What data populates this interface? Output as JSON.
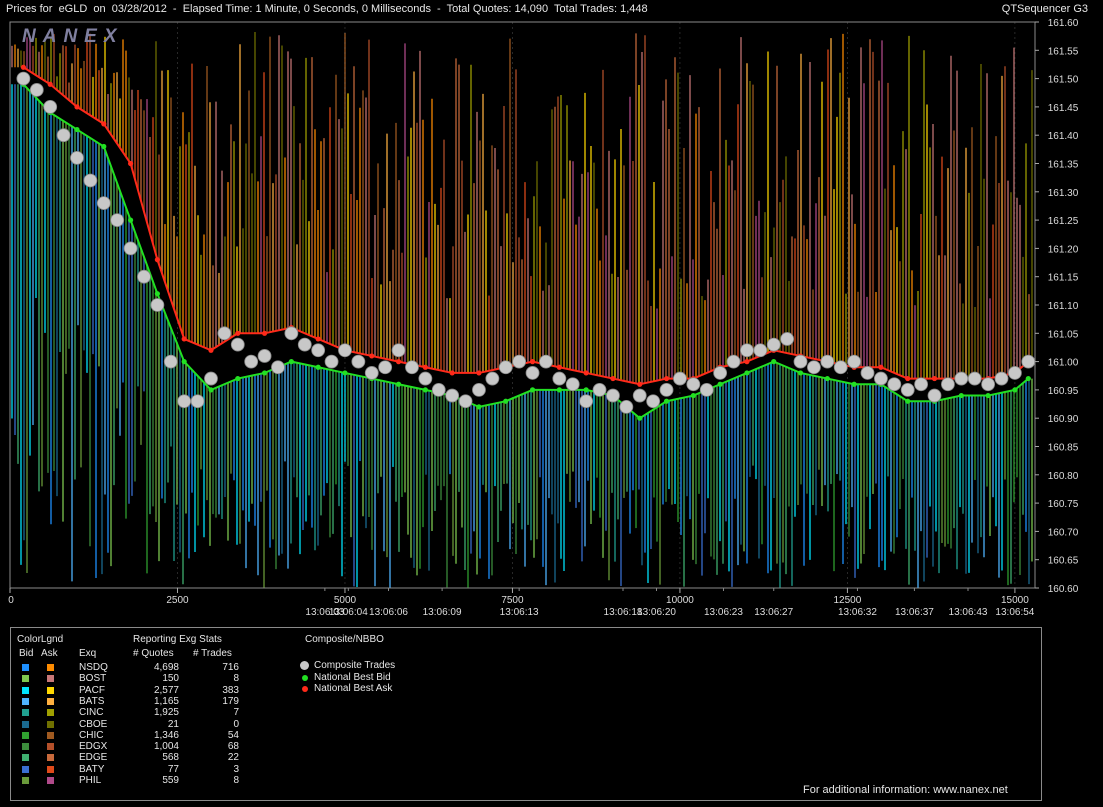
{
  "window": {
    "title": "Prices for  eGLD  on  03/28/2012  -  Elapsed Time: 1 Minute, 0 Seconds, 0 Milliseconds  -  Total Quotes: 14,090  Total Trades: 1,448",
    "app_name": "QTSequencer G3"
  },
  "watermark": "NANEX",
  "chart_data": {
    "type": "line",
    "title": "",
    "xlabel": "",
    "ylabel": "",
    "ylim": [
      160.6,
      161.6
    ],
    "xlim": [
      0,
      15300
    ],
    "y_ticks": [
      "161.60",
      "161.55",
      "161.50",
      "161.45",
      "161.40",
      "161.35",
      "161.30",
      "161.25",
      "161.20",
      "161.15",
      "161.10",
      "161.05",
      "161.00",
      "160.95",
      "160.90",
      "160.85",
      "160.80",
      "160.75",
      "160.70",
      "160.65",
      "160.60"
    ],
    "x_ticks": [
      {
        "x": 0,
        "label": "0"
      },
      {
        "x": 2500,
        "label": "2500"
      },
      {
        "x": 5000,
        "label": "5000"
      },
      {
        "x": 7500,
        "label": "7500"
      },
      {
        "x": 10000,
        "label": "10000"
      },
      {
        "x": 12500,
        "label": "12500"
      },
      {
        "x": 15000,
        "label": "15000"
      }
    ],
    "time_ticks": [
      {
        "x": 4700,
        "label": "13:06:03"
      },
      {
        "x": 5050,
        "label": "13:06:04"
      },
      {
        "x": 5650,
        "label": "13:06:06"
      },
      {
        "x": 6450,
        "label": "13:06:09"
      },
      {
        "x": 7600,
        "label": "13:06:13"
      },
      {
        "x": 9150,
        "label": "13:06:18"
      },
      {
        "x": 9650,
        "label": "13:06:20"
      },
      {
        "x": 10650,
        "label": "13:06:23"
      },
      {
        "x": 11400,
        "label": "13:06:27"
      },
      {
        "x": 12650,
        "label": "13:06:32"
      },
      {
        "x": 13500,
        "label": "13:06:37"
      },
      {
        "x": 14300,
        "label": "13:06:43"
      },
      {
        "x": 15000,
        "label": "13:06:54"
      }
    ],
    "series": [
      {
        "name": "Composite Trades",
        "color": "#c8c8c8",
        "x": [
          200,
          400,
          600,
          800,
          1000,
          1200,
          1400,
          1600,
          1800,
          2000,
          2200,
          2400,
          2600,
          2800,
          3000,
          3200,
          3400,
          3600,
          3800,
          4000,
          4200,
          4400,
          4600,
          4800,
          5000,
          5200,
          5400,
          5600,
          5800,
          6000,
          6200,
          6400,
          6600,
          6800,
          7000,
          7200,
          7400,
          7600,
          7800,
          8000,
          8200,
          8400,
          8600,
          8800,
          9000,
          9200,
          9400,
          9600,
          9800,
          10000,
          10200,
          10400,
          10600,
          10800,
          11000,
          11200,
          11400,
          11600,
          11800,
          12000,
          12200,
          12400,
          12600,
          12800,
          13000,
          13200,
          13400,
          13600,
          13800,
          14000,
          14200,
          14400,
          14600,
          14800,
          15000,
          15200
        ],
        "y": [
          161.5,
          161.48,
          161.45,
          161.4,
          161.36,
          161.32,
          161.28,
          161.25,
          161.2,
          161.15,
          161.1,
          161.0,
          160.93,
          160.93,
          160.97,
          161.05,
          161.03,
          161.0,
          161.01,
          160.99,
          161.05,
          161.03,
          161.02,
          161.0,
          161.02,
          161.0,
          160.98,
          160.99,
          161.02,
          160.99,
          160.97,
          160.95,
          160.94,
          160.93,
          160.95,
          160.97,
          160.99,
          161.0,
          160.98,
          161.0,
          160.97,
          160.96,
          160.93,
          160.95,
          160.94,
          160.92,
          160.94,
          160.93,
          160.95,
          160.97,
          160.96,
          160.95,
          160.98,
          161.0,
          161.02,
          161.02,
          161.03,
          161.04,
          161.0,
          160.99,
          161.0,
          160.99,
          161.0,
          160.98,
          160.97,
          160.96,
          160.95,
          160.96,
          160.94,
          160.96,
          160.97,
          160.97,
          160.96,
          160.97,
          160.98,
          161.0
        ]
      },
      {
        "name": "National Best Bid",
        "color": "#22e022",
        "x": [
          200,
          600,
          1000,
          1400,
          1800,
          2200,
          2600,
          3000,
          3400,
          3800,
          4200,
          4600,
          5000,
          5400,
          5800,
          6200,
          6600,
          7000,
          7400,
          7800,
          8200,
          8600,
          9000,
          9400,
          9800,
          10200,
          10600,
          11000,
          11400,
          11800,
          12200,
          12600,
          13000,
          13400,
          13800,
          14200,
          14600,
          15000,
          15200
        ],
        "y": [
          161.49,
          161.44,
          161.41,
          161.38,
          161.25,
          161.12,
          161.0,
          160.95,
          160.97,
          160.98,
          161.0,
          160.99,
          160.98,
          160.97,
          160.96,
          160.95,
          160.94,
          160.92,
          160.93,
          160.95,
          160.95,
          160.95,
          160.94,
          160.9,
          160.93,
          160.94,
          160.96,
          160.98,
          161.0,
          160.98,
          160.97,
          160.96,
          160.96,
          160.93,
          160.93,
          160.94,
          160.94,
          160.95,
          160.97
        ]
      },
      {
        "name": "National Best Ask",
        "color": "#ff2a1a",
        "x": [
          200,
          600,
          1000,
          1400,
          1800,
          2200,
          2600,
          3000,
          3400,
          3800,
          4200,
          4600,
          5000,
          5400,
          5800,
          6200,
          6600,
          7000,
          7400,
          7800,
          8200,
          8600,
          9000,
          9400,
          9800,
          10200,
          10600,
          11000,
          11400,
          11800,
          12200,
          12600,
          13000,
          13400,
          13800,
          14200,
          14600,
          15000,
          15200
        ],
        "y": [
          161.52,
          161.49,
          161.45,
          161.42,
          161.35,
          161.18,
          161.04,
          161.02,
          161.05,
          161.05,
          161.06,
          161.04,
          161.02,
          161.01,
          161.0,
          160.99,
          160.98,
          160.98,
          160.99,
          161.0,
          160.99,
          160.98,
          160.97,
          160.96,
          160.97,
          160.97,
          160.99,
          161.0,
          161.02,
          161.01,
          161.0,
          160.99,
          160.99,
          160.97,
          160.97,
          160.97,
          160.97,
          160.98,
          161.0
        ]
      }
    ]
  },
  "legend": {
    "color_header": "ColorLgnd",
    "bid_header": "Bid",
    "ask_header": "Ask",
    "exq_header": "Exq",
    "stats_header": "Reporting Exg Stats",
    "quotes_header": "# Quotes",
    "trades_header": "# Trades",
    "composite_header": "Composite/NBBO",
    "rows": [
      {
        "exq": "NSDQ",
        "quotes": "4,698",
        "trades": "716",
        "bid_color": "#1e90ff",
        "ask_color": "#ff8c00"
      },
      {
        "exq": "BOST",
        "quotes": "150",
        "trades": "8",
        "bid_color": "#7ec850",
        "ask_color": "#c87878"
      },
      {
        "exq": "PACF",
        "quotes": "2,577",
        "trades": "383",
        "bid_color": "#00e5ff",
        "ask_color": "#ffd700"
      },
      {
        "exq": "BATS",
        "quotes": "1,165",
        "trades": "179",
        "bid_color": "#4fb4ff",
        "ask_color": "#ffb040"
      },
      {
        "exq": "CINC",
        "quotes": "1,925",
        "trades": "7",
        "bid_color": "#20a090",
        "ask_color": "#a0a000"
      },
      {
        "exq": "CBOE",
        "quotes": "21",
        "trades": "0",
        "bid_color": "#1a6a90",
        "ask_color": "#707000"
      },
      {
        "exq": "CHIC",
        "quotes": "1,346",
        "trades": "54",
        "bid_color": "#30a030",
        "ask_color": "#a05a20"
      },
      {
        "exq": "EDGX",
        "quotes": "1,004",
        "trades": "68",
        "bid_color": "#3c8c3c",
        "ask_color": "#b4502a"
      },
      {
        "exq": "EDGE",
        "quotes": "568",
        "trades": "22",
        "bid_color": "#40b070",
        "ask_color": "#c86a3c"
      },
      {
        "exq": "BATY",
        "quotes": "77",
        "trades": "3",
        "bid_color": "#3a6ed0",
        "ask_color": "#e04a1a"
      },
      {
        "exq": "PHIL",
        "quotes": "559",
        "trades": "8",
        "bid_color": "#6a9a3a",
        "ask_color": "#b04a8a"
      }
    ],
    "composite_items": [
      {
        "label": "Composite Trades",
        "color": "#c8c8c8"
      },
      {
        "label": "National Best Bid",
        "color": "#22e022"
      },
      {
        "label": "National Best Ask",
        "color": "#ff2a1a"
      }
    ],
    "footer": "For additional information: www.nanex.net"
  }
}
